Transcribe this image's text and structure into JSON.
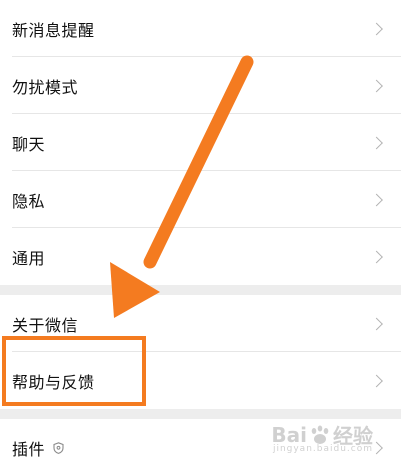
{
  "settings": {
    "group1": [
      {
        "label": "新消息提醒"
      },
      {
        "label": "勿扰模式"
      },
      {
        "label": "聊天"
      },
      {
        "label": "隐私"
      },
      {
        "label": "通用"
      }
    ],
    "group2": [
      {
        "label": "关于微信"
      },
      {
        "label": "帮助与反馈"
      }
    ],
    "group3": [
      {
        "label": "插件"
      }
    ]
  },
  "watermark": {
    "brand_left": "Bai",
    "brand_right": "经验",
    "sub": "jingyan.baidu.com"
  },
  "colors": {
    "annotation": "#f47b20",
    "chevron": "#b3b3b3",
    "background": "#ededed"
  }
}
